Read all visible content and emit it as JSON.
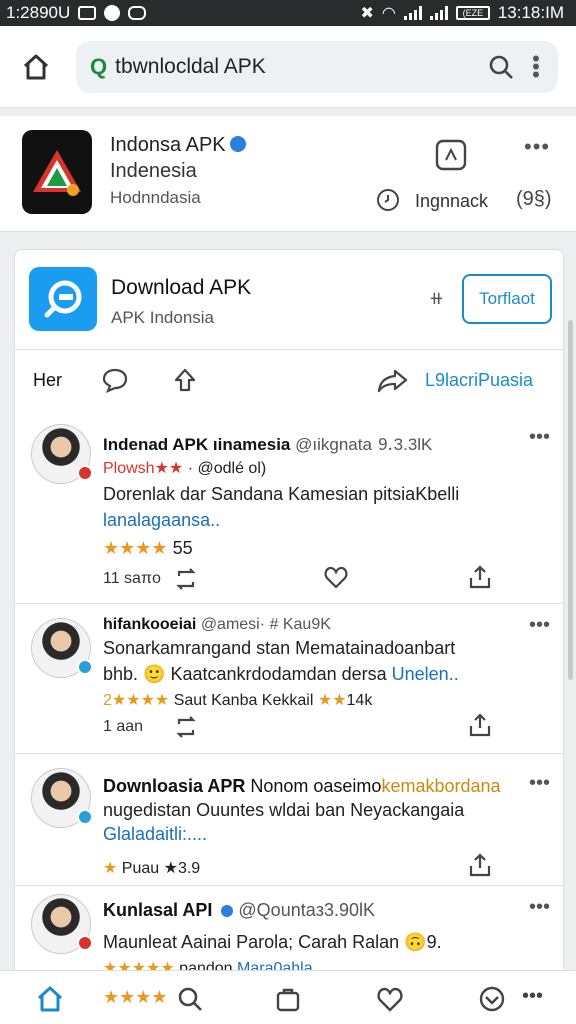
{
  "status": {
    "time_left": "1:2890U",
    "time_right": "13:18:IM",
    "battery": "(EZE"
  },
  "search": {
    "value": "tbwnlocldal APK",
    "q_glyph": "Q"
  },
  "app_card": {
    "title": "Indonsa APK",
    "subtitle": "Indenesia",
    "meta": "Hodnndasia",
    "action_label": "Ingnnack",
    "emoji_glyph": "(9§)"
  },
  "download": {
    "title": "Download APK",
    "subtitle": "APK Indonsia",
    "separator": "⧺",
    "button_label": "Torflaot"
  },
  "actions": {
    "label_left": "Her",
    "link": "L9lacriPuasia"
  },
  "posts": [
    {
      "name": "Indenad APK",
      "name_rest": "ıinamesia",
      "handle": "@ıikgnata ⒐3.3lK",
      "line1_stars": "Plowsh★★",
      "line1_rest": "· @odlé ol)",
      "line2": "Dorenlak dar Sandana Kamesian pitsiaKbelli",
      "line3": "lanalagaansa..",
      "rating_stars": "★★★★",
      "rating_value": "55",
      "reply_count": "11 saπo"
    },
    {
      "name": "hifankooeiai",
      "handle": "@amesi· # Kau9K",
      "line1": "Sonarkamrangand stan Mematainadoanbart",
      "line2_a": "bhb.",
      "line2_b": "Kaatcankrdodamdan dersa",
      "line2_link": "Unelen..",
      "line3_a": "2★★★★",
      "line3_b": "Saut Kanba Kekkail",
      "line3_c": "★★",
      "line3_d": "14k",
      "reply_count": "1 aan"
    },
    {
      "name": "Downloasia APR",
      "name_rest": "Nonom oaseimo",
      "name_tail": "kemakbordana",
      "line1": "nugedistan Ouuntes wldai ban Neyackangaia",
      "line2": "Glaladaitli:....",
      "rating": "Puau ★3.9"
    },
    {
      "name": "Kunlasal API",
      "handle": "@Qountaз3.90lK",
      "line1": "Maunleat Aainai Parola; Carah Ralan",
      "line1_tail": "9.",
      "line2_stars": "★★★★★",
      "line2_rest": "pandon",
      "line2_link": "Mara0ahla"
    }
  ],
  "bottom_nav": {
    "stars": "★★★★"
  },
  "colors": {
    "accent": "#1a8acf",
    "star": "#e89a1c",
    "status_bar": "#2a2b2d"
  }
}
